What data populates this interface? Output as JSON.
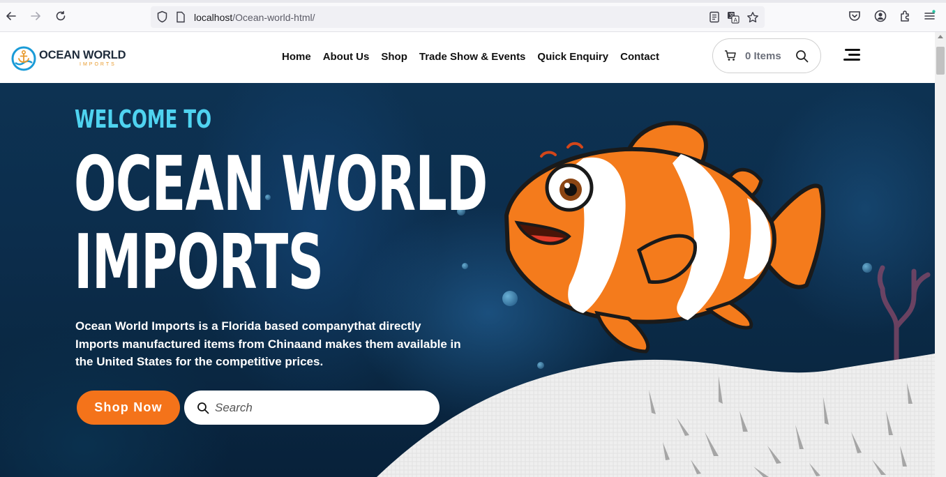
{
  "browser": {
    "url_host": "localhost",
    "url_path": "/Ocean-world-html/"
  },
  "header": {
    "logo_name": "OCEAN WORLD",
    "logo_sub": "IMPORTS",
    "nav": [
      {
        "label": "Home"
      },
      {
        "label": "About Us"
      },
      {
        "label": "Shop"
      },
      {
        "label": "Trade Show & Events"
      },
      {
        "label": "Quick Enquiry"
      },
      {
        "label": "Contact"
      }
    ],
    "cart_label": "0 Items"
  },
  "hero": {
    "welcome": "WELCOME TO",
    "title_line1": "OCEAN WORLD",
    "title_line2": "IMPORTS",
    "description": "Ocean World Imports is a Florida based companythat directly Imports manufactured items from Chinaand makes them available in the United States for the competitive prices.",
    "shop_button": "Shop Now",
    "search_placeholder": "Search"
  },
  "colors": {
    "accent_orange": "#f4731a",
    "welcome_cyan": "#4fd3f0",
    "hero_bg": "#0c2d4c"
  },
  "icons": [
    "back-arrow-icon",
    "forward-arrow-icon",
    "reload-icon",
    "shield-icon",
    "page-icon",
    "reader-icon",
    "translate-icon",
    "star-icon",
    "pocket-icon",
    "account-icon",
    "extensions-icon",
    "menu-icon",
    "cart-icon",
    "search-icon",
    "hamburger-icon"
  ]
}
